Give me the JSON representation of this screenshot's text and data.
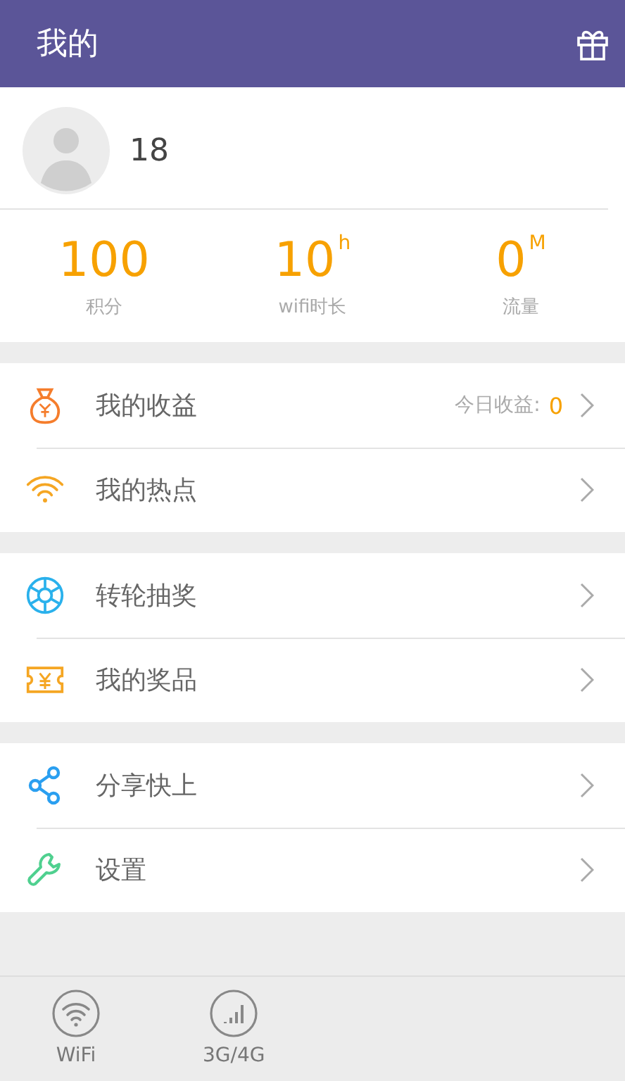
{
  "header": {
    "title": "我的"
  },
  "profile": {
    "phone": "18"
  },
  "stats": [
    {
      "value": "100",
      "label": "积分"
    },
    {
      "value": "10",
      "unit": "h",
      "label": "wifi时长"
    },
    {
      "value": "0",
      "unit": "M",
      "label": "流量"
    }
  ],
  "menu_groups": [
    {
      "items": [
        {
          "kind": "money",
          "label": "我的收益",
          "note": "今日收益:",
          "note_value": "0"
        },
        {
          "kind": "hotspot",
          "label": "我的热点"
        }
      ]
    },
    {
      "items": [
        {
          "kind": "wheel",
          "label": "转轮抽奖"
        },
        {
          "kind": "ticket",
          "label": "我的奖品"
        }
      ]
    },
    {
      "items": [
        {
          "kind": "share",
          "label": "分享快上"
        },
        {
          "kind": "wrench",
          "label": "设置"
        }
      ]
    }
  ],
  "bottom_tabs": [
    {
      "kind": "wifi",
      "label": "WiFi"
    },
    {
      "kind": "signal",
      "label": "3G/4G"
    }
  ]
}
